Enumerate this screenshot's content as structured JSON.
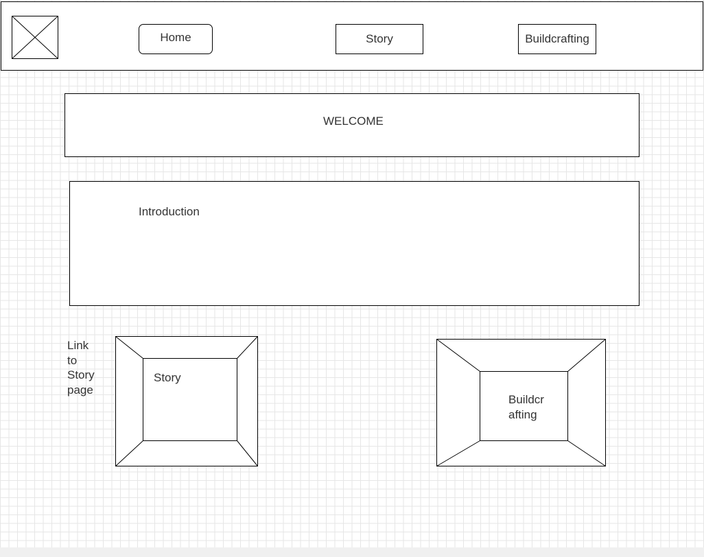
{
  "header": {
    "logo_icon": "image-placeholder-icon",
    "nav": [
      {
        "label": "Home"
      },
      {
        "label": "Story"
      },
      {
        "label": "Buildcrafting"
      }
    ]
  },
  "welcome": {
    "title": "WELCOME"
  },
  "intro": {
    "label": "Introduction"
  },
  "story_card": {
    "side_note": "Link\nto\nStory\npage",
    "label": "Story"
  },
  "build_card": {
    "label": "Buildcr\nafting"
  },
  "colors": {
    "stroke": "#000000",
    "text": "#333333",
    "grid": "#e6e6e6",
    "background": "#ffffff"
  }
}
